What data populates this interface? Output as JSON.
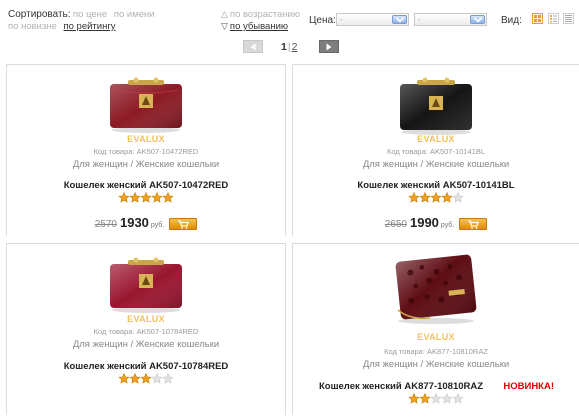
{
  "sort": {
    "label": "Сортировать:",
    "options_row1": [
      "по цене",
      "по имени"
    ],
    "options_row2_inactive": "по новизне",
    "options_row2_active": "по рейтингу",
    "order_asc": "по возрастанию",
    "order_desc": "по убыванию"
  },
  "filter": {
    "price_label": "Цена:",
    "from_value": "-",
    "to_value": "-",
    "view_label": "Вид:"
  },
  "pager": {
    "current": "1",
    "separator": "|",
    "next_page": "2"
  },
  "accent_color": "#f0a020",
  "products": [
    {
      "brand": "EVALUX",
      "code_label": "Код товара:",
      "code": "AK507-10472RED",
      "category": "Для женщин / Женские кошельки",
      "title": "Кошелек женский AK507-10472RED",
      "rating": 5,
      "old_price": "2570",
      "price": "1930",
      "currency": "руб.",
      "color": "#8c1a24"
    },
    {
      "brand": "EVALUX",
      "code_label": "Код товара:",
      "code": "AK507-10141BL",
      "category": "Для женщин / Женские кошельки",
      "title": "Кошелек женский AK507-10141BL",
      "rating": 4,
      "old_price": "2650",
      "price": "1990",
      "currency": "руб.",
      "color": "#151515"
    },
    {
      "brand": "EVALUX",
      "code_label": "Код товара:",
      "code": "AK507-10784RED",
      "category": "Для женщин / Женские кошельки",
      "title": "Кошелек женский AK507-10784RED",
      "rating": 3,
      "color": "#9a1630"
    },
    {
      "brand": "EVALUX",
      "code_label": "Код товара:",
      "code": "AK877-10810RAZ",
      "category": "Для женщин / Женские кошельки",
      "title": "Кошелек женский AK877-10810RAZ",
      "badge": "НОВИНКА!",
      "rating": 2,
      "color": "#5e0d14"
    }
  ]
}
